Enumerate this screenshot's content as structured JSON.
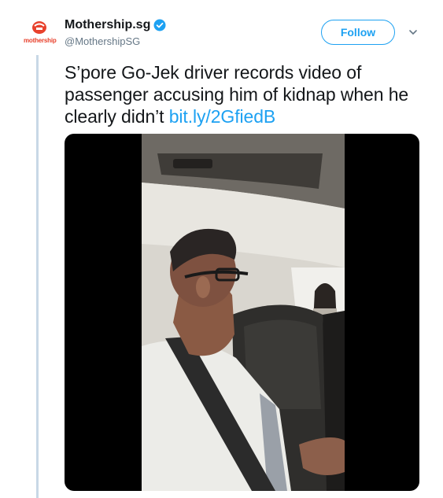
{
  "tweet": {
    "author": {
      "display_name": "Mothership.sg",
      "handle": "@MothershipSG",
      "verified": true,
      "avatar_label": "mothership",
      "avatar_icon": "mothership-logo-icon"
    },
    "follow_label": "Follow",
    "text": "S’pore Go-Jek driver records video of passenger accusing him of kidnap when he clearly didn’t",
    "link": "bit.ly/2GfiedB",
    "media_type": "video"
  },
  "colors": {
    "accent": "#1da1f2",
    "brand": "#e8412c",
    "text": "#14171a",
    "secondary": "#657786",
    "thread": "#c8d8e6"
  }
}
